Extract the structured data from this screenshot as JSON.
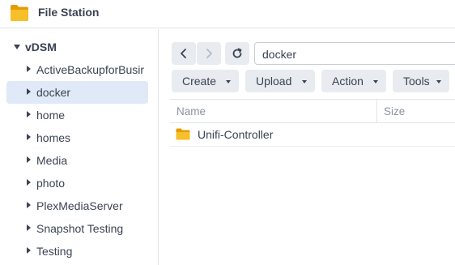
{
  "app": {
    "title": "File Station",
    "icon": "folder-icon"
  },
  "sidebar": {
    "root_label": "vDSM",
    "items": [
      {
        "label": "ActiveBackupforBusir",
        "selected": false
      },
      {
        "label": "docker",
        "selected": true
      },
      {
        "label": "home",
        "selected": false
      },
      {
        "label": "homes",
        "selected": false
      },
      {
        "label": "Media",
        "selected": false
      },
      {
        "label": "photo",
        "selected": false
      },
      {
        "label": "PlexMediaServer",
        "selected": false
      },
      {
        "label": "Snapshot Testing",
        "selected": false
      },
      {
        "label": "Testing",
        "selected": false
      }
    ]
  },
  "navigation": {
    "back_icon": "chevron-left-icon",
    "forward_icon": "chevron-right-icon",
    "refresh_icon": "refresh-icon",
    "path": "docker"
  },
  "toolbar": {
    "create_label": "Create",
    "upload_label": "Upload",
    "action_label": "Action",
    "tools_label": "Tools"
  },
  "file_list": {
    "columns": {
      "name": "Name",
      "size": "Size"
    },
    "rows": [
      {
        "name": "Unifi-Controller",
        "type": "folder",
        "size": ""
      }
    ]
  },
  "colors": {
    "accent_selected": "#dfe9f7",
    "button_bg": "#e8ecf1",
    "folder_yellow": "#f5b51c",
    "text": "#3a4352",
    "muted_text": "#8a93a1"
  }
}
